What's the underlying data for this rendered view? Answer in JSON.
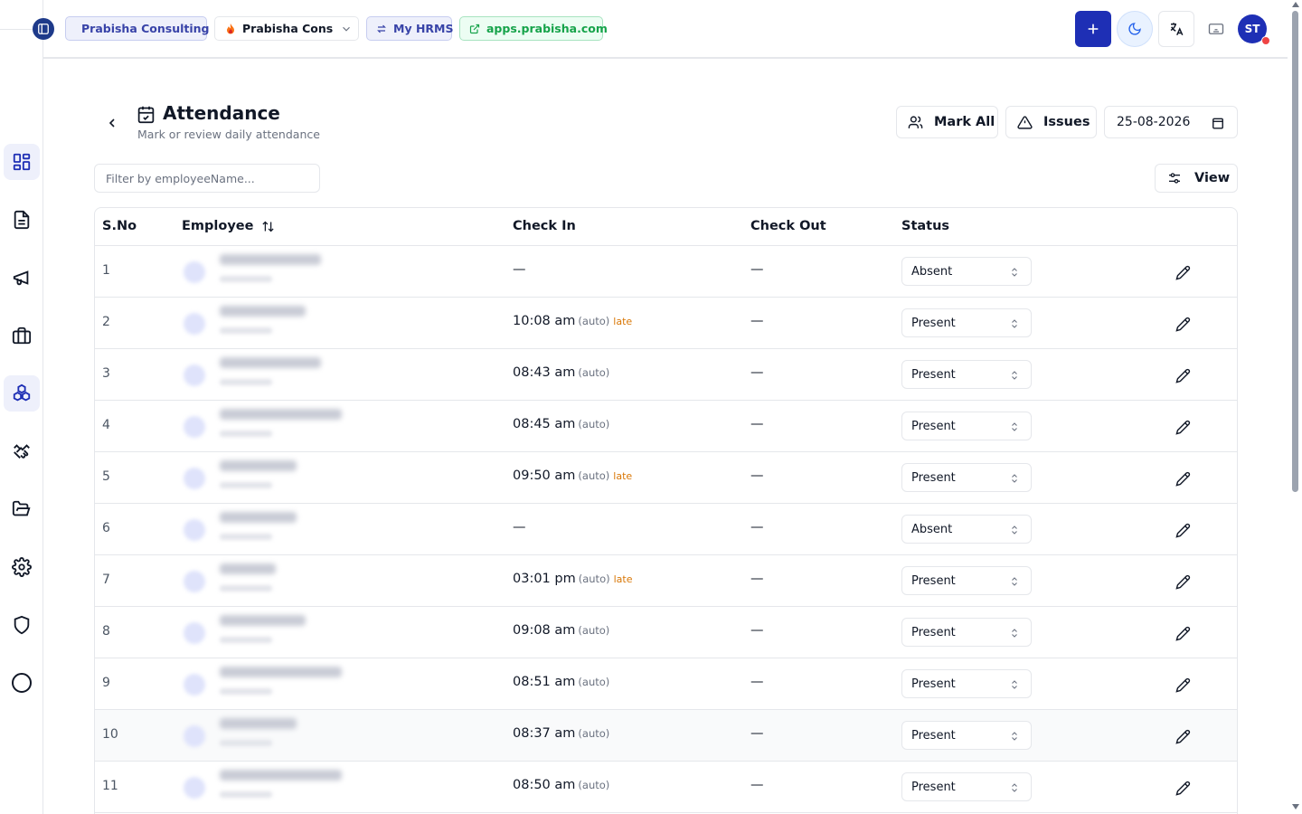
{
  "topbar": {
    "org_label": "Prabisha Consulting",
    "company_select": "Prabisha Cons...",
    "hrms_label": "My HRMS",
    "app_link": "apps.prabisha.com",
    "user_initials": "ST"
  },
  "page": {
    "title": "Attendance",
    "subtitle": "Mark or review daily attendance",
    "mark_all_label": "Mark All",
    "issues_label": "Issues",
    "date_value": "25-08-2026",
    "filter_placeholder": "Filter by employeeName...",
    "view_label": "View"
  },
  "table": {
    "columns": {
      "sno": "S.No",
      "employee": "Employee",
      "check_in": "Check In",
      "check_out": "Check Out",
      "status": "Status"
    },
    "rows": [
      {
        "sno": "1",
        "check_in_time": "—",
        "auto": "",
        "late": "",
        "check_out": "—",
        "status": "Absent"
      },
      {
        "sno": "2",
        "check_in_time": "10:08 am",
        "auto": "(auto)",
        "late": "late",
        "check_out": "—",
        "status": "Present"
      },
      {
        "sno": "3",
        "check_in_time": "08:43 am",
        "auto": "(auto)",
        "late": "",
        "check_out": "—",
        "status": "Present"
      },
      {
        "sno": "4",
        "check_in_time": "08:45 am",
        "auto": "(auto)",
        "late": "",
        "check_out": "—",
        "status": "Present"
      },
      {
        "sno": "5",
        "check_in_time": "09:50 am",
        "auto": "(auto)",
        "late": "late",
        "check_out": "—",
        "status": "Present"
      },
      {
        "sno": "6",
        "check_in_time": "—",
        "auto": "",
        "late": "",
        "check_out": "—",
        "status": "Absent"
      },
      {
        "sno": "7",
        "check_in_time": "03:01 pm",
        "auto": "(auto)",
        "late": "late",
        "check_out": "—",
        "status": "Present"
      },
      {
        "sno": "8",
        "check_in_time": "09:08 am",
        "auto": "(auto)",
        "late": "",
        "check_out": "—",
        "status": "Present"
      },
      {
        "sno": "9",
        "check_in_time": "08:51 am",
        "auto": "(auto)",
        "late": "",
        "check_out": "—",
        "status": "Present"
      },
      {
        "sno": "10",
        "check_in_time": "08:37 am",
        "auto": "(auto)",
        "late": "",
        "check_out": "—",
        "status": "Present"
      },
      {
        "sno": "11",
        "check_in_time": "08:50 am",
        "auto": "(auto)",
        "late": "",
        "check_out": "—",
        "status": "Present"
      }
    ]
  },
  "sidebar": {
    "items": [
      {
        "icon": "dashboard-grid-icon",
        "active": true
      },
      {
        "icon": "document-icon",
        "active": false
      },
      {
        "icon": "megaphone-icon",
        "active": false
      },
      {
        "icon": "briefcase-icon",
        "active": false
      },
      {
        "icon": "boxes-icon",
        "active": true
      },
      {
        "icon": "handshake-icon",
        "active": false
      },
      {
        "icon": "folder-open-icon",
        "active": false
      },
      {
        "icon": "settings-gear-icon",
        "active": false
      },
      {
        "icon": "shield-icon",
        "active": false
      },
      {
        "icon": "circle-icon",
        "active": false
      }
    ]
  },
  "colors": {
    "accent": "#1e2fb5",
    "late": "#d97706",
    "link_green": "#16a34a",
    "notification": "#ef4444"
  }
}
